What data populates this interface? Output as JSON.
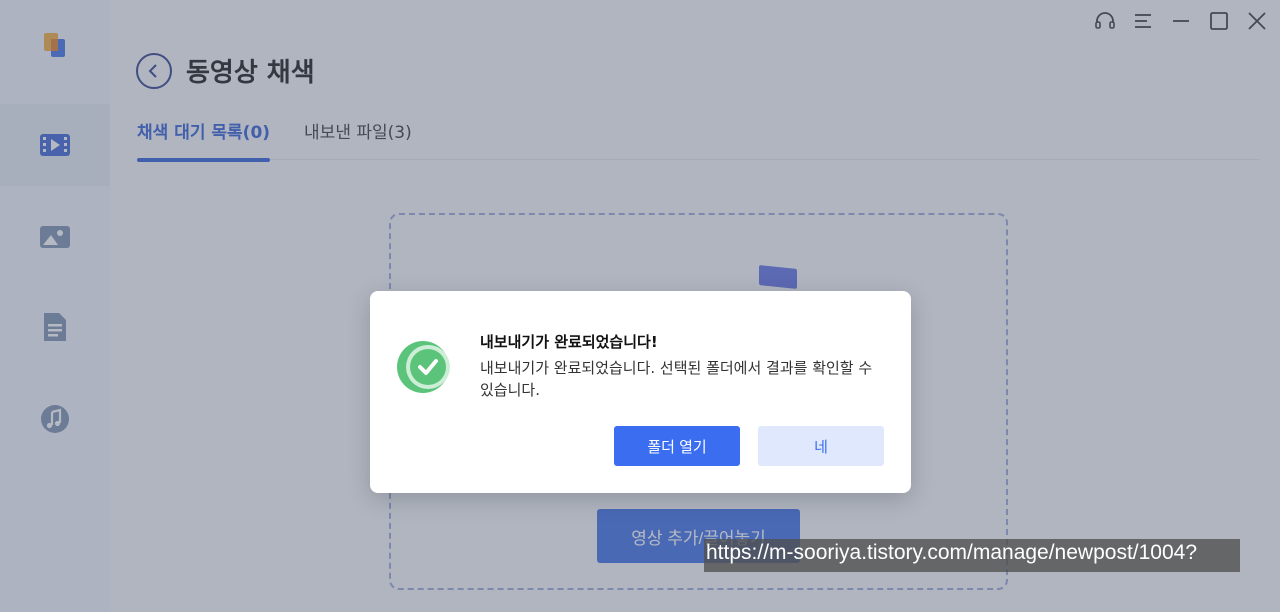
{
  "app": {
    "page_title": "동영상 채색",
    "accent_color": "#2f5bd8"
  },
  "sidebar": {
    "items": [
      {
        "icon": "app-logo-icon"
      },
      {
        "icon": "video-icon",
        "active": true
      },
      {
        "icon": "image-icon"
      },
      {
        "icon": "document-icon"
      },
      {
        "icon": "music-icon"
      }
    ]
  },
  "window_controls": [
    "headset-icon",
    "menu-icon",
    "minimize-icon",
    "maximize-icon",
    "close-icon"
  ],
  "tabs": [
    {
      "label": "채색 대기 목록(0)",
      "active": true
    },
    {
      "label": "내보낸 파일(3)",
      "active": false
    }
  ],
  "dropzone": {
    "add_button_label": "영상 추가/끌어놓기"
  },
  "dialog": {
    "title": "내보내기가 완료되었습니다!",
    "message": "내보내기가 완료되었습니다. 선택된 폴더에서 결과를 확인할 수 있습니다.",
    "open_folder_label": "폴더 열기",
    "ok_label": "네",
    "success_color": "#5cc47a"
  },
  "watermark": {
    "url": "https://m-sooriya.tistory.com/manage/newpost/1004?"
  }
}
